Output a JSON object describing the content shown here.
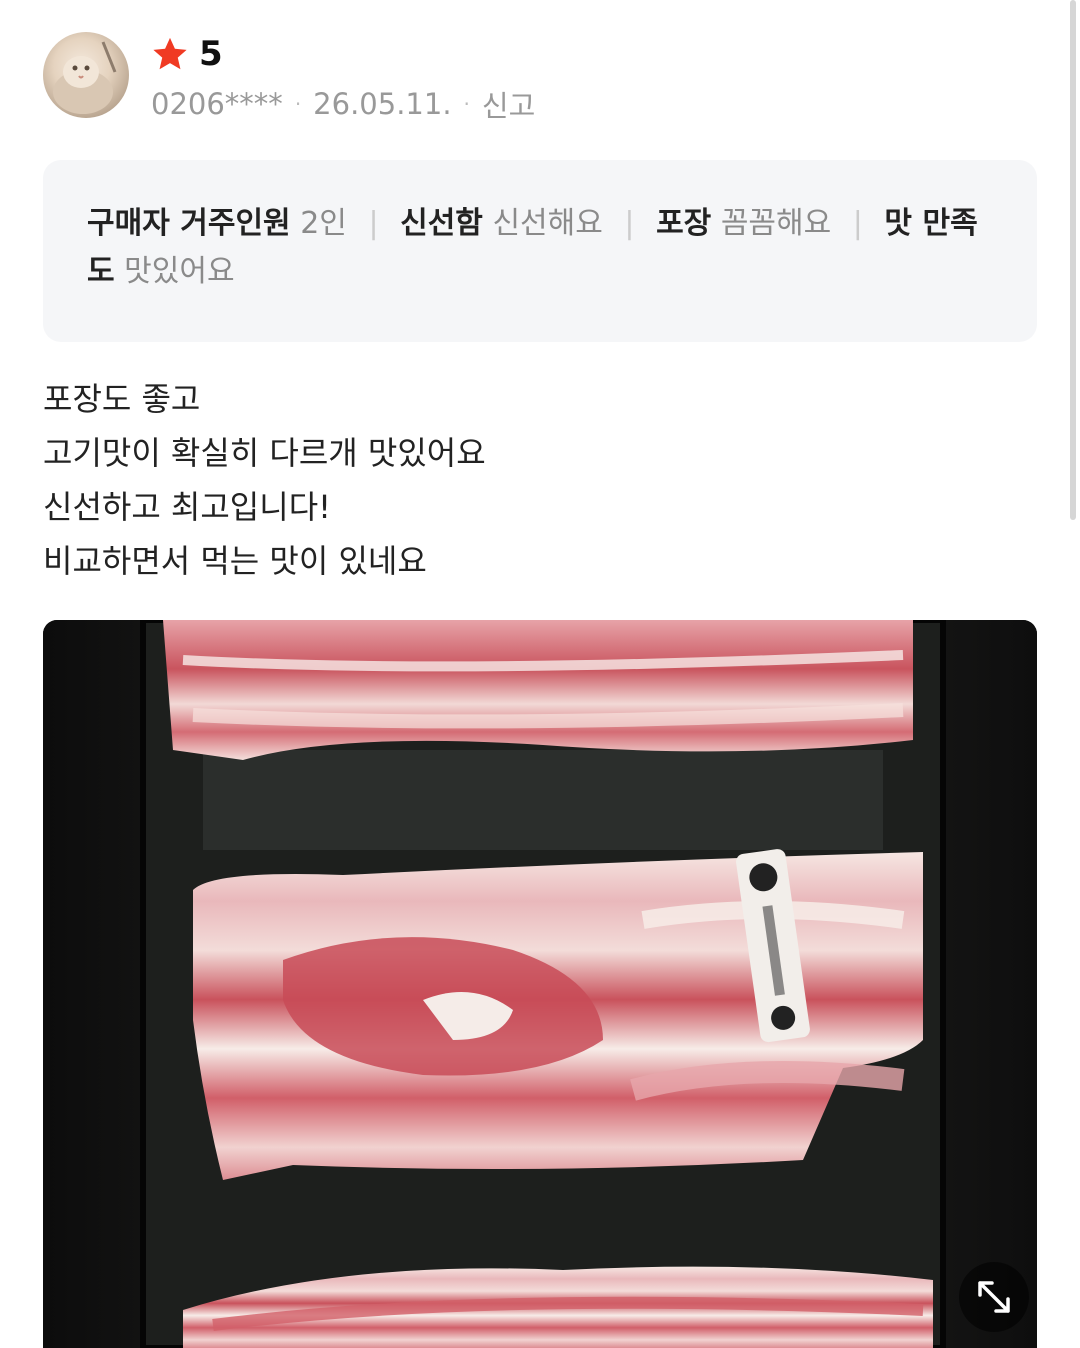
{
  "review": {
    "rating": "5",
    "star_color": "#f03a23",
    "user_id": "0206****",
    "date": "26.05.11.",
    "report_label": "신고",
    "attributes": [
      {
        "key": "구매자 거주인원",
        "value": "2인"
      },
      {
        "key": "신선함",
        "value": "신선해요"
      },
      {
        "key": "포장",
        "value": "꼼꼼해요"
      },
      {
        "key": "맛 만족도",
        "value": "맛있어요"
      }
    ],
    "body_lines": [
      "포장도 좋고",
      "고기맛이 확실히 다르개 맛있어요",
      "신선하고 최고입니다!",
      "비교하면서 먹는 맛이 있네요"
    ],
    "photo_icon": "expand-icon"
  }
}
